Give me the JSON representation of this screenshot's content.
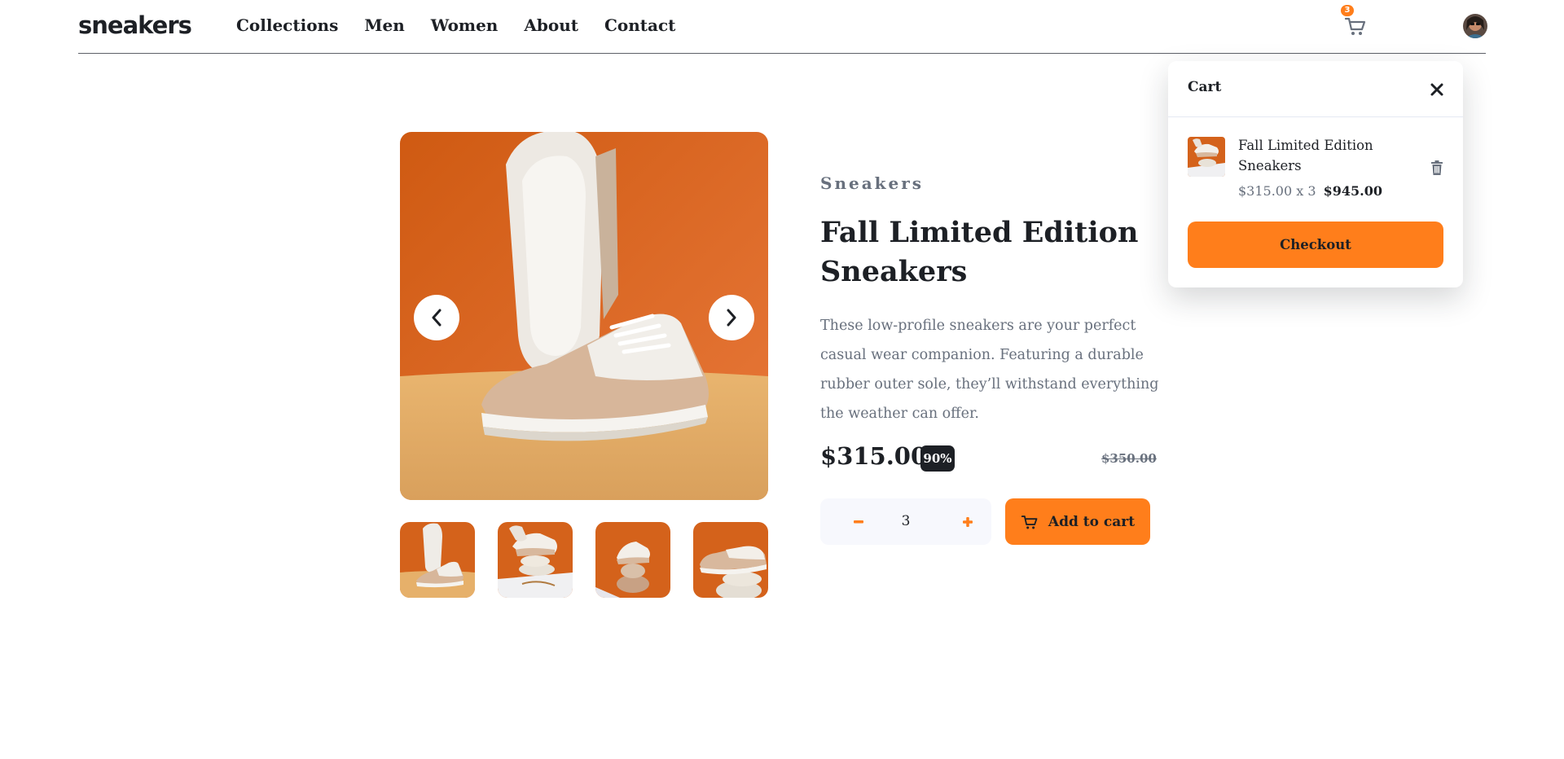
{
  "header": {
    "logo": "sneakers",
    "nav": [
      "Collections",
      "Men",
      "Women",
      "About",
      "Contact"
    ],
    "cart_count": "3",
    "cart_icon": "cart-icon",
    "avatar_icon": "user-avatar"
  },
  "gallery": {
    "prev_icon": "chevron-left-icon",
    "next_icon": "chevron-right-icon",
    "thumbnail_count": 4
  },
  "product": {
    "company": "Sneakers",
    "title": "Fall Limited Edition Sneakers",
    "description": "These low-profile sneakers are your perfect casual wear companion. Featuring a durable rubber outer sole, they’ll withstand everything the weather can offer.",
    "price": "$315.00",
    "discount": "90%",
    "original_price": "$350.00",
    "quantity": "3",
    "minus_icon": "minus-icon",
    "plus_icon": "plus-icon",
    "add_to_cart": "Add to cart"
  },
  "cart": {
    "title": "Cart",
    "close_icon": "close-icon",
    "item": {
      "name": "Fall Limited Edition Sneakers",
      "calc": "$315.00 x 3",
      "total": "$945.00",
      "delete_icon": "trash-icon"
    },
    "checkout": "Checkout"
  },
  "colors": {
    "accent": "#ff7e1b",
    "dark": "#1d2025",
    "muted": "#68707d",
    "light": "#f7f8fd"
  }
}
